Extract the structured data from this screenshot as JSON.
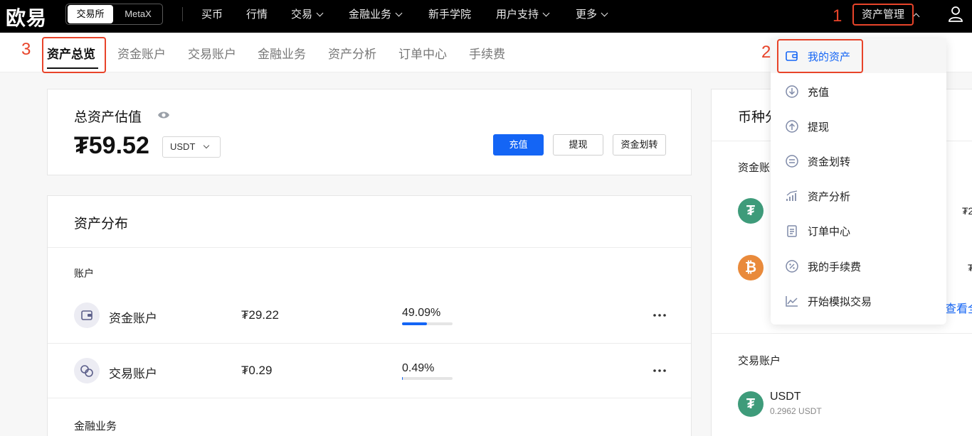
{
  "nav": {
    "logo": "欧易",
    "switch": [
      "交易所",
      "MetaX"
    ],
    "items": [
      {
        "label": "买币",
        "chevron": false
      },
      {
        "label": "行情",
        "chevron": false
      },
      {
        "label": "交易",
        "chevron": true
      },
      {
        "label": "金融业务",
        "chevron": true
      },
      {
        "label": "新手学院",
        "chevron": false
      },
      {
        "label": "用户支持",
        "chevron": true
      },
      {
        "label": "更多",
        "chevron": true
      }
    ],
    "asset_mgmt": "资产管理"
  },
  "annotations": [
    "1",
    "2",
    "3"
  ],
  "subnav": {
    "tabs": [
      "资产总览",
      "资金账户",
      "交易账户",
      "金融业务",
      "资产分析",
      "订单中心",
      "手续费"
    ],
    "active": 0
  },
  "overview": {
    "title": "总资产估值",
    "value": "₮59.52",
    "currency": "USDT",
    "buttons": {
      "deposit": "充值",
      "withdraw": "提现",
      "transfer": "资金划转"
    }
  },
  "distribution": {
    "title": "资产分布",
    "account_label": "账户",
    "accounts": [
      {
        "name": "资金账户",
        "value": "₮29.22",
        "pct": "49.09%",
        "fill": 0.4909
      },
      {
        "name": "交易账户",
        "value": "₮0.29",
        "pct": "0.49%",
        "fill": 0.0049
      }
    ],
    "finance_label": "金融业务"
  },
  "right": {
    "title": "币种分",
    "fund_label": "资金账",
    "clip_1": "₮2",
    "clip_2": "₮",
    "view_all": "查看全",
    "trade_label": "交易账户",
    "trade_coin": "USDT",
    "trade_amount": "0.2962 USDT",
    "coin_t": "₮",
    "coin_b": "₿"
  },
  "dropdown": {
    "items": [
      {
        "label": "我的资产",
        "icon": "wallet-icon"
      },
      {
        "label": "充值",
        "icon": "deposit-icon"
      },
      {
        "label": "提现",
        "icon": "withdraw-icon"
      },
      {
        "label": "资金划转",
        "icon": "transfer-icon"
      },
      {
        "label": "资产分析",
        "icon": "analysis-icon"
      },
      {
        "label": "订单中心",
        "icon": "order-icon"
      },
      {
        "label": "我的手续费",
        "icon": "fee-icon"
      },
      {
        "label": "开始模拟交易",
        "icon": "demo-trade-icon"
      }
    ]
  },
  "colors": {
    "accent": "#1465f5",
    "annotation": "#e8442a",
    "tether": "#3e9b7a",
    "bitcoin": "#e98a3b"
  }
}
